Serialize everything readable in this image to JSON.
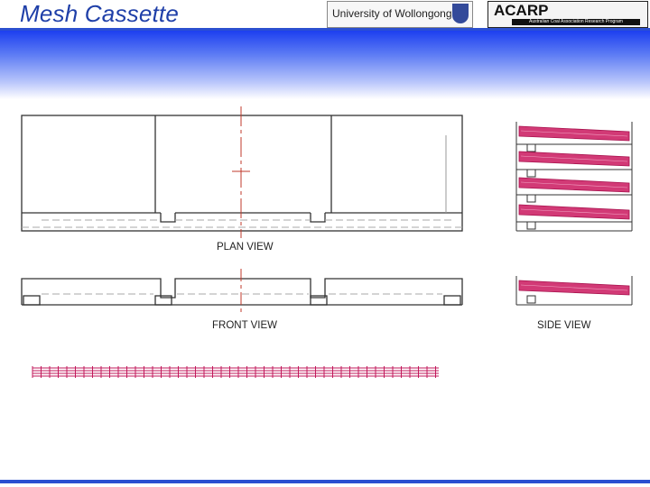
{
  "header": {
    "title": "Mesh Cassette",
    "logos": {
      "university": "University of Wollongong",
      "acarp": "ACARP",
      "acarp_sub": "Australian Coal Association Research Program"
    }
  },
  "views": {
    "plan": "PLAN VIEW",
    "front": "FRONT VIEW",
    "side": "SIDE VIEW"
  },
  "colors": {
    "title": "#1f3fa8",
    "band_top": "#1d3ff0",
    "centerline": "#c0392b",
    "mesh": "#c2185b",
    "outline": "#333333"
  }
}
